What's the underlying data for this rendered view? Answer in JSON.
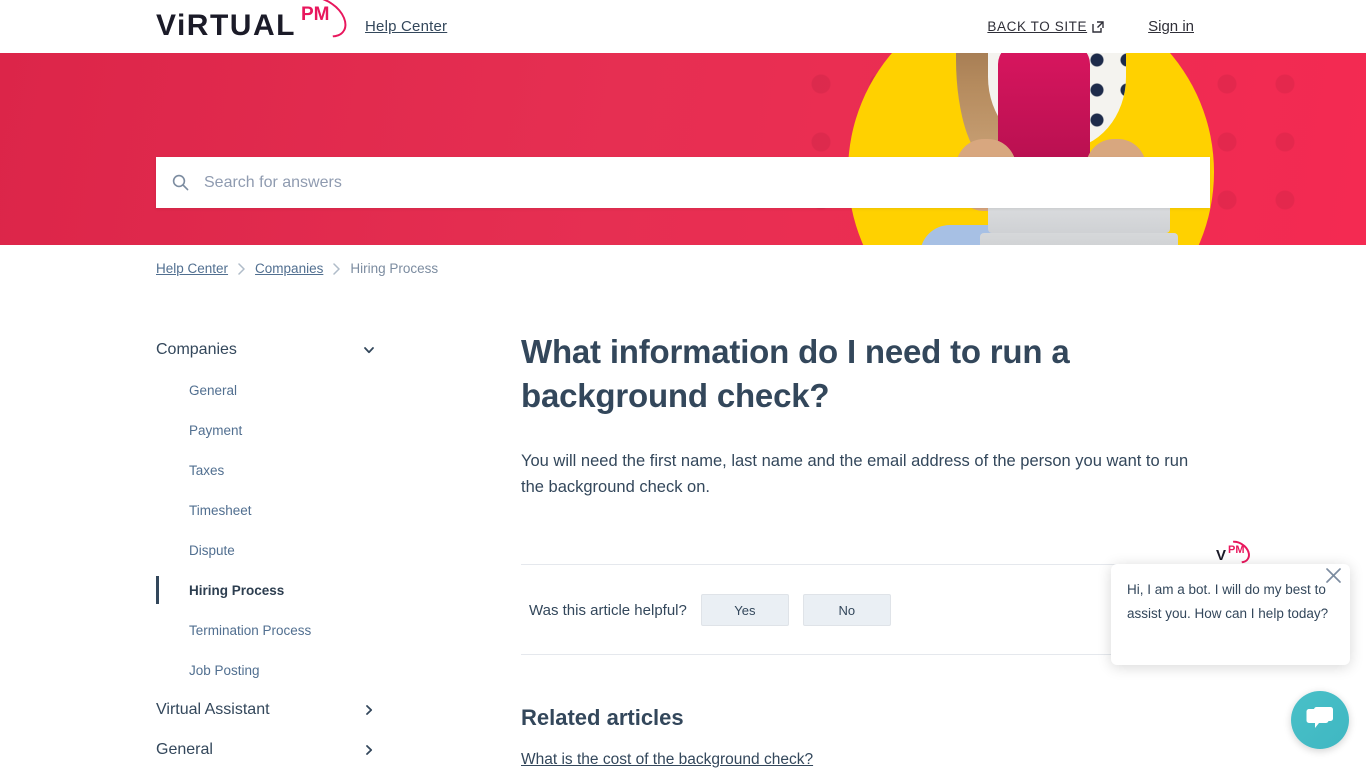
{
  "header": {
    "logo_main": "ViRTUAL",
    "logo_accent": "PM",
    "help_center": "Help Center",
    "back_to_site": "BACK TO SITE",
    "back_to_site_icon": "external-link-icon",
    "sign_in": "Sign in"
  },
  "hero": {
    "search_placeholder": "Search for answers",
    "search_value": "",
    "search_icon": "search-icon",
    "bg_color": "#e62f52",
    "accent_circle_color": "#ffd100"
  },
  "breadcrumb": {
    "items": [
      {
        "label": "Help Center"
      },
      {
        "label": "Companies"
      },
      {
        "label": "Hiring Process"
      }
    ],
    "separator_icon": "chevron-right-icon"
  },
  "sidebar": {
    "groups": [
      {
        "label": "Companies",
        "icon": "chevron-down-icon",
        "expanded": true,
        "items": [
          {
            "label": "General",
            "active": false
          },
          {
            "label": "Payment",
            "active": false
          },
          {
            "label": "Taxes",
            "active": false
          },
          {
            "label": "Timesheet",
            "active": false
          },
          {
            "label": "Dispute",
            "active": false
          },
          {
            "label": "Hiring Process",
            "active": true
          },
          {
            "label": "Termination Process",
            "active": false
          },
          {
            "label": "Job Posting",
            "active": false
          }
        ]
      },
      {
        "label": "Virtual Assistant",
        "icon": "chevron-right-icon",
        "expanded": false,
        "items": []
      },
      {
        "label": "General",
        "icon": "chevron-right-icon",
        "expanded": false,
        "items": []
      }
    ],
    "active_color": "#33475b"
  },
  "article": {
    "title": "What information do I need to run a background check?",
    "body": "You will need the first name, last name and the email address of the person you want to run the background check on.",
    "feedback_label": "Was this article helpful?",
    "feedback_yes": "Yes",
    "feedback_no": "No",
    "related_title": "Related articles",
    "related_items": [
      {
        "label": "What is the cost of the background check?"
      }
    ]
  },
  "chat": {
    "avatar_logo_letter": "V",
    "avatar_logo_accent": "PM",
    "message": "Hi, I am a bot. I will do my best to assist you. How can I help today?",
    "close_icon": "close-icon",
    "fab_icon": "chat-bubble-icon",
    "fab_color": "#45bcc4"
  }
}
